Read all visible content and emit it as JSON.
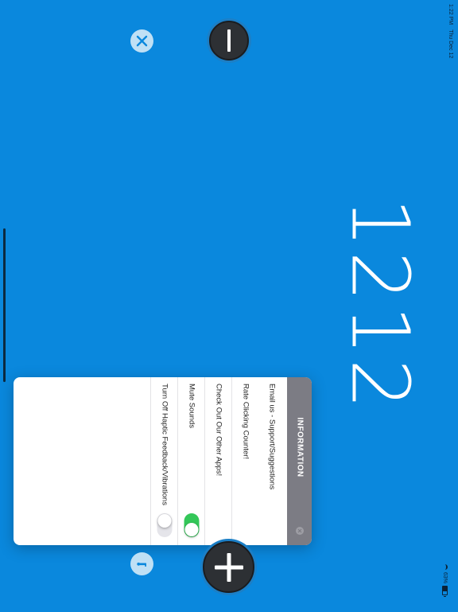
{
  "status_bar": {
    "time": "1:22 PM",
    "date": "Thu Dec 12",
    "battery": "63%"
  },
  "counter": {
    "value": "1212"
  },
  "controls": {
    "decrement_icon": "minus-icon",
    "increment_icon": "plus-icon",
    "reset_icon": "close-icon",
    "info_icon": "info-icon"
  },
  "info_panel": {
    "title": "INFORMATION",
    "items": [
      {
        "label": "Email us - Support/Suggestions"
      },
      {
        "label": "Rate Clicking Counter!"
      },
      {
        "label": "Check Out Our Other Apps!"
      },
      {
        "label": "Mute Sounds",
        "toggle": true
      },
      {
        "label": "Turn Off Haptic Feedback/Vibrations",
        "toggle": false
      }
    ]
  },
  "colors": {
    "background": "#0a88dd",
    "button_dark": "#2d3034",
    "toggle_on": "#34c759",
    "header_gray": "#7c7c84"
  }
}
